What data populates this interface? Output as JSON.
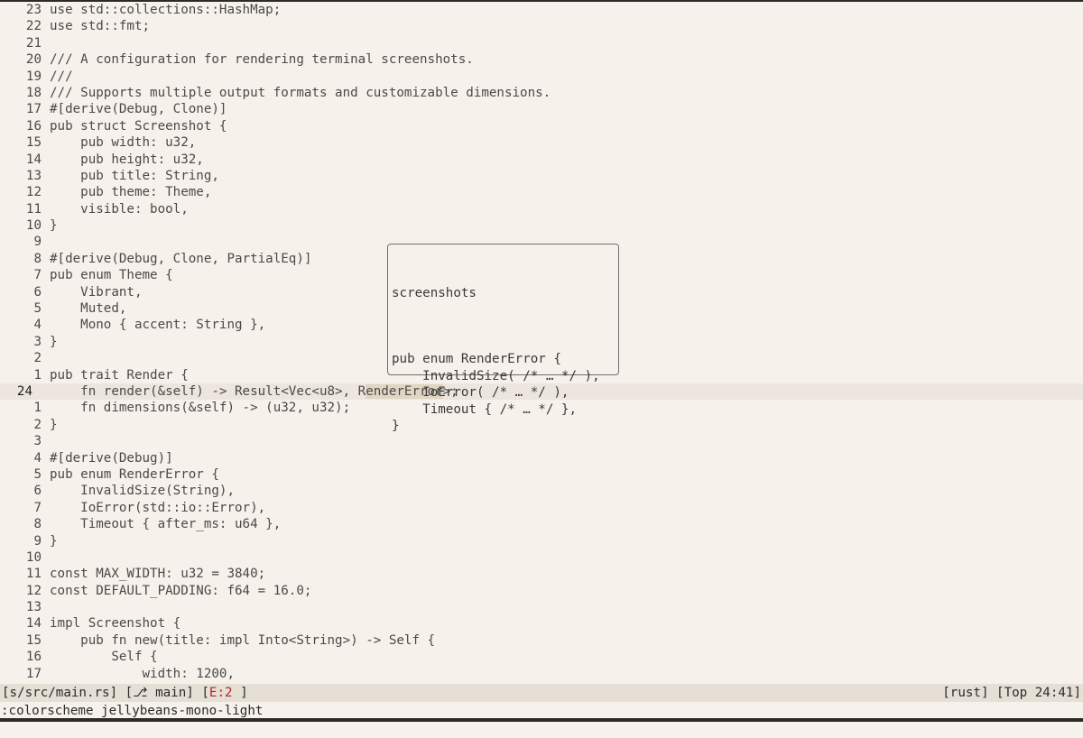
{
  "editor": {
    "lines": [
      {
        "ln": "23",
        "code": "use std::collections::HashMap;"
      },
      {
        "ln": "22",
        "code": "use std::fmt;"
      },
      {
        "ln": "21",
        "code": ""
      },
      {
        "ln": "20",
        "code": "/// A configuration for rendering terminal screenshots."
      },
      {
        "ln": "19",
        "code": "///"
      },
      {
        "ln": "18",
        "code": "/// Supports multiple output formats and customizable dimensions."
      },
      {
        "ln": "17",
        "code": "#[derive(Debug, Clone)]"
      },
      {
        "ln": "16",
        "code": "pub struct Screenshot {"
      },
      {
        "ln": "15",
        "code": "    pub width: u32,"
      },
      {
        "ln": "14",
        "code": "    pub height: u32,"
      },
      {
        "ln": "13",
        "code": "    pub title: String,"
      },
      {
        "ln": "12",
        "code": "    pub theme: Theme,"
      },
      {
        "ln": "11",
        "code": "    visible: bool,"
      },
      {
        "ln": "10",
        "code": "}"
      },
      {
        "ln": "9",
        "code": ""
      },
      {
        "ln": "8",
        "code": "#[derive(Debug, Clone, PartialEq)]"
      },
      {
        "ln": "7",
        "code": "pub enum Theme {"
      },
      {
        "ln": "6",
        "code": "    Vibrant,"
      },
      {
        "ln": "5",
        "code": "    Muted,"
      },
      {
        "ln": "4",
        "code": "    Mono { accent: String },"
      },
      {
        "ln": "3",
        "code": "}"
      },
      {
        "ln": "2",
        "code": ""
      },
      {
        "ln": "1",
        "code": "pub trait Render {"
      },
      {
        "ln": "24",
        "code": "    fn render(&self) -> Result<Vec<u8>, RenderError>;",
        "current": true
      },
      {
        "ln": "1",
        "code": "    fn dimensions(&self) -> (u32, u32);"
      },
      {
        "ln": "2",
        "code": "}"
      },
      {
        "ln": "3",
        "code": ""
      },
      {
        "ln": "4",
        "code": "#[derive(Debug)]"
      },
      {
        "ln": "5",
        "code": "pub enum RenderError {"
      },
      {
        "ln": "6",
        "code": "    InvalidSize(String),"
      },
      {
        "ln": "7",
        "code": "    IoError(std::io::Error),"
      },
      {
        "ln": "8",
        "code": "    Timeout { after_ms: u64 },"
      },
      {
        "ln": "9",
        "code": "}"
      },
      {
        "ln": "10",
        "code": ""
      },
      {
        "ln": "11",
        "code": "const MAX_WIDTH: u32 = 3840;"
      },
      {
        "ln": "12",
        "code": "const DEFAULT_PADDING: f64 = 16.0;"
      },
      {
        "ln": "13",
        "code": ""
      },
      {
        "ln": "14",
        "code": "impl Screenshot {"
      },
      {
        "ln": "15",
        "code": "    pub fn new(title: impl Into<String>) -> Self {"
      },
      {
        "ln": "16",
        "code": "        Self {"
      },
      {
        "ln": "17",
        "code": "            width: 1200,"
      }
    ]
  },
  "hover_popup": {
    "module": "screenshots",
    "lines": [
      "",
      "pub enum RenderError {",
      "    InvalidSize( /* … */ ),",
      "    IoError( /* … */ ),",
      "    Timeout { /* … */ },",
      "}"
    ]
  },
  "statusbar": {
    "path": "[s/src/main.rs]",
    "branch": "[⎇ main]",
    "errors_open": "[",
    "errors": "E:2",
    "errors_close": " ]",
    "filetype": "[rust]",
    "position": "[Top 24:41]"
  },
  "cmdline": {
    "text": ":colorscheme jellybeans-mono-light"
  },
  "colors": {
    "background": "#f6f1ea",
    "current_line": "#ece6de",
    "match_highlight": "#e3d5c3",
    "function": "#3f5a8a",
    "error": "#b3222d"
  }
}
